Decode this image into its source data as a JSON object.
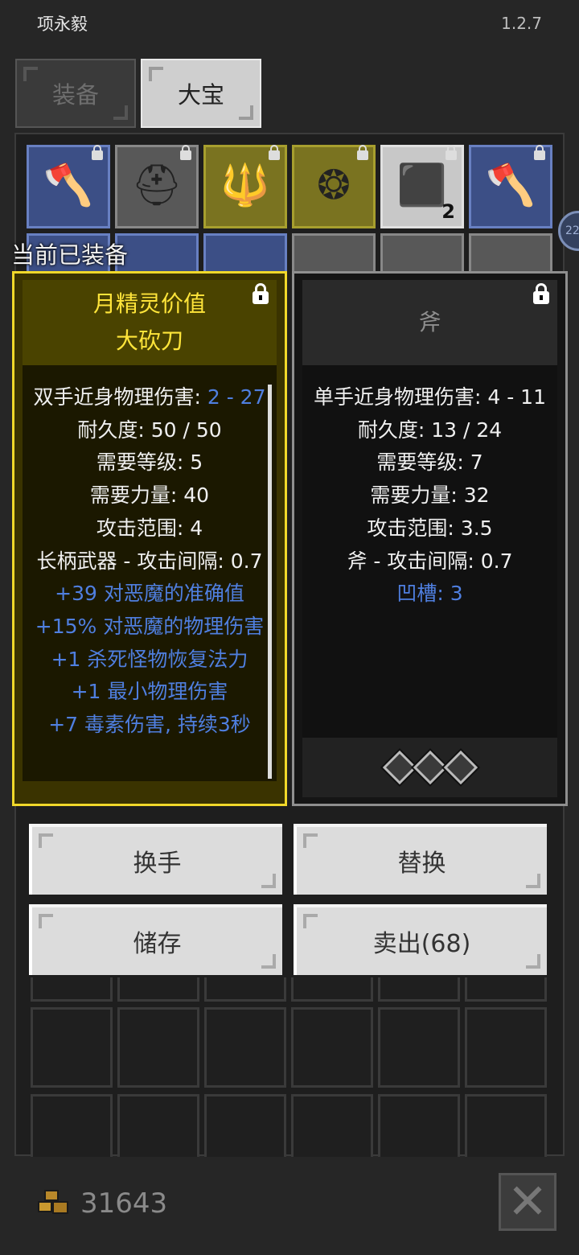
{
  "status_bar": {
    "title": "项永毅",
    "version": "1.2.7"
  },
  "tabs": [
    {
      "label": "装备",
      "active": false
    },
    {
      "label": "大宝",
      "active": true
    }
  ],
  "inventory_row1": [
    {
      "icon": "axe-icon",
      "rarity": "blue",
      "count": ""
    },
    {
      "icon": "helmet-icon",
      "rarity": "gray",
      "count": ""
    },
    {
      "icon": "trident-icon",
      "rarity": "yellow",
      "count": ""
    },
    {
      "icon": "shield-icon",
      "rarity": "yellow",
      "count": ""
    },
    {
      "icon": "gem-icon",
      "rarity": "white",
      "count": "2"
    },
    {
      "icon": "axe-icon",
      "rarity": "blue",
      "count": ""
    }
  ],
  "side_badge": "22",
  "section_label": "当前已装备",
  "compare": {
    "left": {
      "title_lines": [
        "月精灵价值",
        "大砍刀"
      ],
      "stats": [
        {
          "key": "双手近身物理伤害: ",
          "value": "2 - 27",
          "value_blue": true
        },
        {
          "key": "耐久度: ",
          "value": "50 / 50"
        },
        {
          "key": "需要等级: ",
          "value": "5"
        },
        {
          "key": "需要力量: ",
          "value": "40"
        },
        {
          "key": "攻击范围: ",
          "value": "4"
        },
        {
          "key": "长柄武器 - 攻击间隔: ",
          "value": "0.7"
        }
      ],
      "mods": [
        "+39 对恶魔的准确值",
        "+15% 对恶魔的物理伤害",
        "+1 杀死怪物恢复法力",
        "+1 最小物理伤害",
        "+7 毒素伤害, 持续3秒"
      ]
    },
    "right": {
      "title_lines": [
        "斧"
      ],
      "stats": [
        {
          "key": "单手近身物理伤害: ",
          "value": "4 - 11"
        },
        {
          "key": "耐久度: ",
          "value": "13 / 24"
        },
        {
          "key": "需要等级: ",
          "value": "7"
        },
        {
          "key": "需要力量: ",
          "value": "32"
        },
        {
          "key": "攻击范围: ",
          "value": "3.5"
        },
        {
          "key": "斧 - 攻击间隔: ",
          "value": "0.7"
        }
      ],
      "mods": [
        "凹槽: 3"
      ],
      "sockets": 3
    }
  },
  "actions": {
    "swap_hands": "换手",
    "replace": "替换",
    "store": "储存",
    "sell": "卖出(68)"
  },
  "gold": "31643"
}
